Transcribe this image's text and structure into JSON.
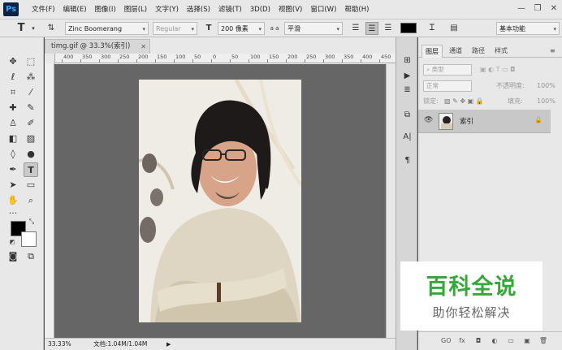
{
  "app": {
    "logo": "Ps"
  },
  "menus": [
    "文件(F)",
    "编辑(E)",
    "图像(I)",
    "图层(L)",
    "文字(Y)",
    "选择(S)",
    "滤镜(T)",
    "3D(D)",
    "视图(V)",
    "窗口(W)",
    "帮助(H)"
  ],
  "window_controls": {
    "minimize": "—",
    "restore": "❐",
    "close": "✕"
  },
  "options": {
    "tool_glyph": "T",
    "font_family": "Zinc Boomerang",
    "font_style": "Regular",
    "font_size": "200 像素",
    "aa_label": "a a",
    "aa_mode": "平滑",
    "workspace": "基本功能"
  },
  "document": {
    "tab_title": "timg.gif @ 33.3%(索引)",
    "ruler_labels": [
      "400",
      "350",
      "300",
      "250",
      "200",
      "150",
      "100",
      "50",
      "0",
      "50",
      "100",
      "150",
      "200",
      "250",
      "300",
      "350",
      "400",
      "450"
    ],
    "zoom": "33.33%",
    "doc_info": "文档:1.04M/1.04M"
  },
  "layers_panel": {
    "tabs": [
      "图层",
      "通道",
      "路径",
      "样式"
    ],
    "filter_label": "类型",
    "blend_mode": "正常",
    "opacity_label": "不透明度:",
    "opacity_value": "100%",
    "lock_label": "锁定:",
    "fill_label": "填充:",
    "fill_value": "100%",
    "layer_name": "索引",
    "bottom_icons": [
      "GO",
      "fx",
      "◘",
      "◐",
      "▭",
      "▣",
      "🗑"
    ]
  },
  "watermark": {
    "title": "百科全说",
    "subtitle": "助你轻松解决"
  },
  "colors": {
    "chrome": "#e8e8e8",
    "canvas_bg": "#666666",
    "logo_bg": "#0b2244",
    "logo_fg": "#31a8ff",
    "watermark_green": "#35a839"
  }
}
